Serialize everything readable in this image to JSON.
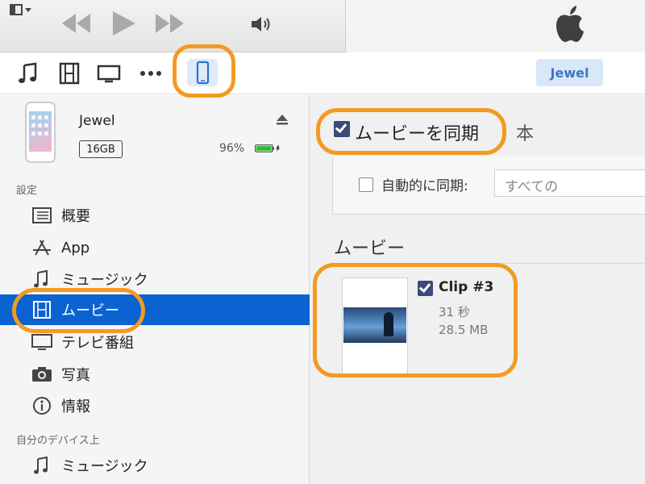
{
  "player": {
    "icons": [
      "menu-toggle-icon",
      "rewind-icon",
      "play-icon",
      "fast-forward-icon",
      "volume-icon",
      "apple-logo-icon"
    ]
  },
  "nav": {
    "icons": [
      "music-note-icon",
      "film-icon",
      "tv-icon",
      "more-icon",
      "iphone-icon"
    ],
    "device_button": "Jewel"
  },
  "device": {
    "name": "Jewel",
    "capacity": "16GB",
    "battery_percent": "96%"
  },
  "sidebar": {
    "settings_label": "設定",
    "items": [
      {
        "label": "概要",
        "icon": "list-icon"
      },
      {
        "label": "App",
        "icon": "app-store-icon"
      },
      {
        "label": "ミュージック",
        "icon": "music-note-icon"
      },
      {
        "label": "ムービー",
        "icon": "film-icon",
        "active": true
      },
      {
        "label": "テレビ番組",
        "icon": "tv-icon"
      },
      {
        "label": "写真",
        "icon": "camera-icon"
      },
      {
        "label": "情報",
        "icon": "info-icon"
      }
    ],
    "mydevice_label": "自分のデバイス上",
    "mydevice_items": [
      {
        "label": "ミュージック",
        "icon": "music-note-icon"
      }
    ]
  },
  "main": {
    "sync_label": "ムービーを同期",
    "sync_count": "本",
    "auto_sync_label": "自動的に同期:",
    "auto_sync_value": "すべての",
    "movies_heading": "ムービー",
    "clip": {
      "name": "Clip #3",
      "duration": "31 秒",
      "size": "28.5 MB"
    }
  },
  "colors": {
    "highlight_ring": "#f39a22",
    "active_blue": "#0b63d1",
    "device_button_bg": "#d9e8f8"
  }
}
